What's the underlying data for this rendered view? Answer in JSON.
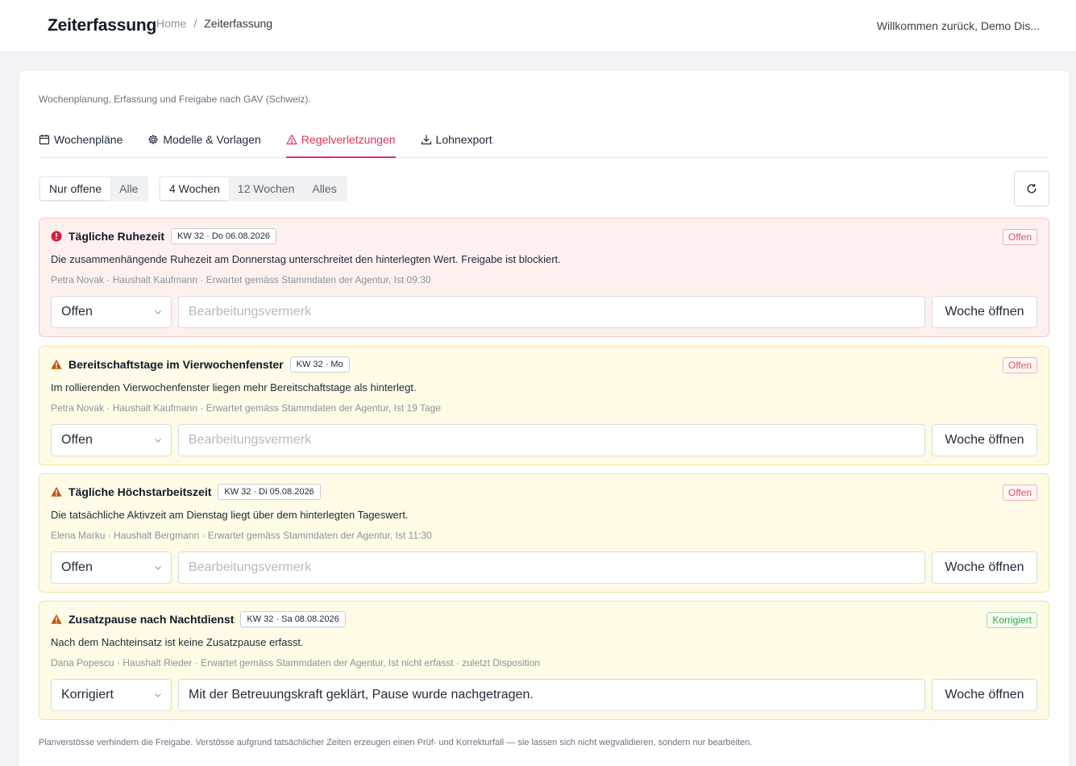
{
  "header": {
    "title": "Zeiterfassung",
    "breadcrumb": {
      "home": "Home",
      "separator": "/",
      "current": "Zeiterfassung"
    },
    "welcome": "Willkommen zurück, Demo Dis..."
  },
  "page": {
    "subtitle": "Wochenplanung, Erfassung und Freigabe nach GAV (Schweiz).",
    "tabs": [
      {
        "label": "Wochenpläne",
        "icon": "calendar-icon"
      },
      {
        "label": "Modelle & Vorlagen",
        "icon": "gear-icon"
      },
      {
        "label": "Regelverletzungen",
        "icon": "warning-triangle-icon",
        "active": true
      },
      {
        "label": "Lohnexport",
        "icon": "download-icon"
      }
    ],
    "filters": {
      "status": [
        "Nur offene",
        "Alle"
      ],
      "status_selected": "Nur offene",
      "range": [
        "4 Wochen",
        "12 Wochen",
        "Alles"
      ],
      "range_selected": "4 Wochen"
    },
    "refresh_icon": "refresh-icon",
    "note_placeholder": "Bearbeitungsvermerk",
    "open_week_label": "Woche öffnen",
    "violations": [
      {
        "severity": "error",
        "title": "Tägliche Ruhezeit",
        "week": "KW 32 · Do 06.08.2026",
        "badge": "Offen",
        "description": "Die zusammenhängende Ruhezeit am Donnerstag unterschreitet den hinterlegten Wert. Freigabe ist blockiert.",
        "meta": "Petra Novak · Haushalt Kaufmann · Erwartet gemäss Stammdaten der Agentur, Ist 09:30",
        "status": "Offen",
        "note": ""
      },
      {
        "severity": "warning",
        "title": "Bereitschaftstage im Vierwochenfenster",
        "week": "KW 32 · Mo",
        "badge": "Offen",
        "description": "Im rollierenden Vierwochenfenster liegen mehr Bereitschaftstage als hinterlegt.",
        "meta": "Petra Novak · Haushalt Kaufmann · Erwartet gemäss Stammdaten der Agentur, Ist 19 Tage",
        "status": "Offen",
        "note": ""
      },
      {
        "severity": "warning",
        "title": "Tägliche Höchstarbeitszeit",
        "week": "KW 32 · Di 05.08.2026",
        "badge": "Offen",
        "description": "Die tatsächliche Aktivzeit am Dienstag liegt über dem hinterlegten Tageswert.",
        "meta": "Elena Marku · Haushalt Bergmann · Erwartet gemäss Stammdaten der Agentur, Ist 11:30",
        "status": "Offen",
        "note": ""
      },
      {
        "severity": "warning",
        "title": "Zusatzpause nach Nachtdienst",
        "week": "KW 32 · Sa 08.08.2026",
        "badge": "Korrigiert",
        "description": "Nach dem Nachteinsatz ist keine Zusatzpause erfasst.",
        "meta": "Dana Popescu · Haushalt Rieder · Erwartet gemäss Stammdaten der Agentur, Ist nicht erfasst · zuletzt Disposition",
        "status": "Korrigiert",
        "note": "Mit der Betreuungskraft geklärt, Pause wurde nachgetragen."
      }
    ],
    "footnote": "Planverstösse verhindern die Freigabe. Verstösse aufgrund tatsächlicher Zeiten erzeugen einen Prüf- und Korrekturfall — sie lassen sich nicht wegvalidieren, sondern nur bearbeiten."
  },
  "colors": {
    "accent": "#e0315b",
    "error_bg": "#fff0f0",
    "warning_bg": "#fffbe6",
    "badge_open": "#e05262",
    "badge_fixed": "#3aa24a"
  }
}
